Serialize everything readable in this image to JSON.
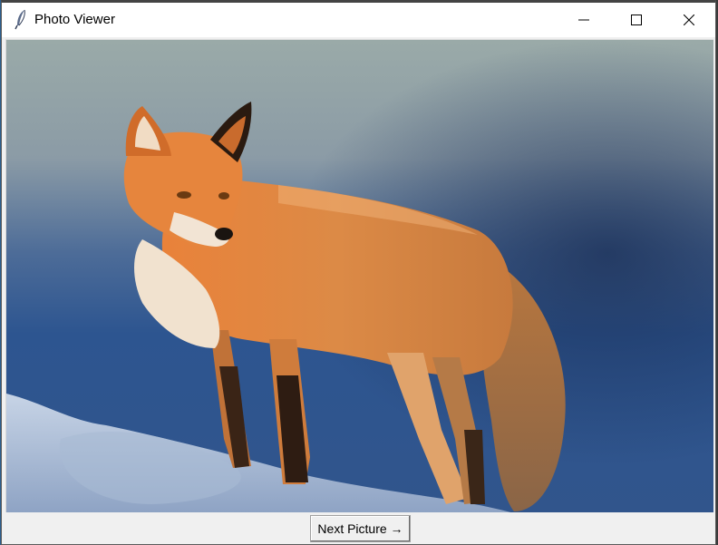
{
  "window": {
    "title": "Photo Viewer",
    "icon": "feather-icon"
  },
  "title_controls": {
    "minimize_icon": "minimize-icon",
    "maximize_icon": "maximize-icon",
    "close_icon": "close-icon"
  },
  "viewer": {
    "image_subject": "red fox standing on snow"
  },
  "buttons": {
    "next_label": "Next Picture →"
  },
  "colors": {
    "titlebar": "#ffffff",
    "window_bg": "#f0f0f0",
    "button_face": "#f0f0f0"
  }
}
